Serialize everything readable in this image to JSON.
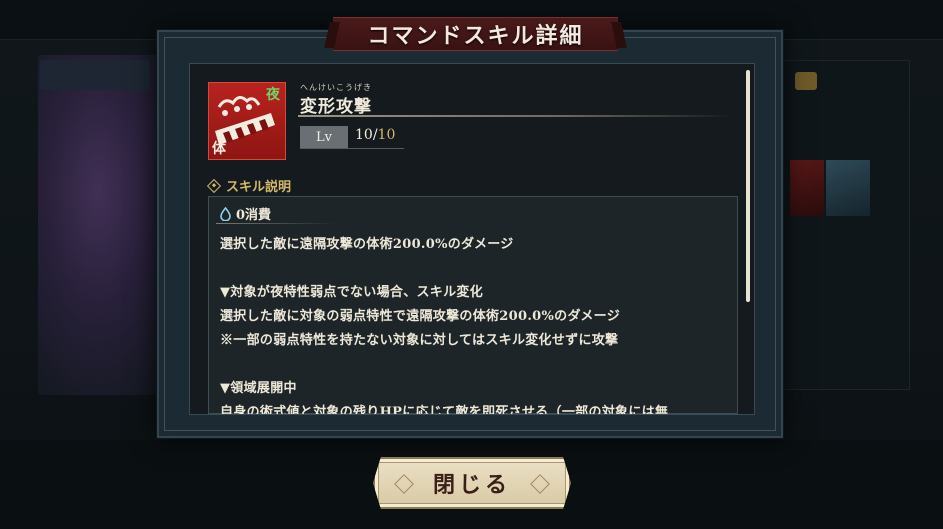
{
  "dialog": {
    "title": "コマンドスキル詳細",
    "skill": {
      "ruby": "へんけいこうげき",
      "name": "変形攻撃",
      "tag_night": "夜",
      "tag_body": "体",
      "level_label": "Lv",
      "level_current": "10",
      "level_separator": "/",
      "level_max": "10"
    },
    "section_label": "スキル説明",
    "cost": "0消費",
    "description_lines": [
      "選択した敵に遠隔攻撃の体術200.0%のダメージ",
      "",
      "▼対象が夜特性弱点でない場合、スキル変化",
      "選択した敵に対象の弱点特性で遠隔攻撃の体術200.0%のダメージ",
      "※一部の弱点特性を持たない対象に対してはスキル変化せずに攻撃",
      "",
      "▼領域展開中",
      "自身の術式値と対象の残りHPに応じて敵を即死させる（一部の対象には無"
    ],
    "close_label": "閉じる"
  },
  "icons": {
    "skill": "drill-arm-skill-icon",
    "section": "diamond-icon",
    "cost": "water-drop-icon"
  },
  "colors": {
    "accent_gold": "#d4b86a",
    "night_tag": "#6fd36a",
    "banner": "#4a1a1a",
    "skill_icon_bg": "#b8231f"
  }
}
